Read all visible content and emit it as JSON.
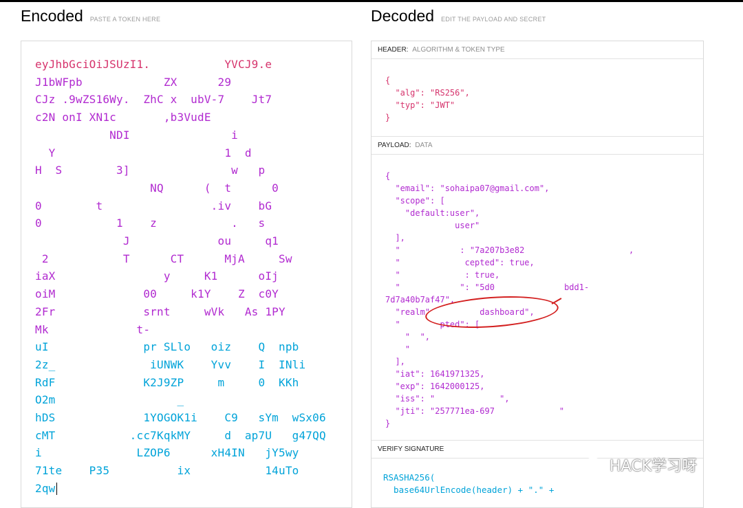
{
  "encoded": {
    "title": "Encoded",
    "subtitle": "PASTE A TOKEN HERE",
    "lines": [
      {
        "text": "eyJhbGciOiJSUzI1.           YVCJ9.e",
        "cls": "header"
      },
      {
        "text": "J1bWFpb            ZX      29",
        "cls": "payload"
      },
      {
        "text": "CJz .9wZS16Wy.  ZhC x  ubV-7    Jt7",
        "cls": "payload"
      },
      {
        "text": "c2N onI XN1c       ,b3VudE",
        "cls": "payload"
      },
      {
        "text": "           NDI               i",
        "cls": "payload"
      },
      {
        "text": "  Y                         1  d",
        "cls": "payload"
      },
      {
        "text": "H  S        3]               w   p",
        "cls": "payload"
      },
      {
        "text": "                 NQ      (  t      0",
        "cls": "payload"
      },
      {
        "text": "0        t                .iv    bG",
        "cls": "payload"
      },
      {
        "text": "0           1    z           .   s",
        "cls": "payload"
      },
      {
        "text": "             J             ou     q1",
        "cls": "payload"
      },
      {
        "text": " 2           T      CT      MjA     Sw",
        "cls": "payload"
      },
      {
        "text": "iaX                y     K1      oIj",
        "cls": "payload"
      },
      {
        "text": "oiM             00     k1Y    Z  c0Y",
        "cls": "payload"
      },
      {
        "text": "2Fr             srnt     wVk   As 1PY",
        "cls": "payload"
      },
      {
        "text": "Mk             t-",
        "cls": "payload"
      },
      {
        "text": "uI              pr SLlo   oiz    Q  npb",
        "cls": "sig"
      },
      {
        "text": "2z_              iUNWK    Yvv    I  INli",
        "cls": "sig"
      },
      {
        "text": "RdF             K2J9ZP     m     0  KKh",
        "cls": "sig"
      },
      {
        "text": "O2m                  _",
        "cls": "sig"
      },
      {
        "text": "hDS             1YOGOK1i    C9   sYm  wSx06",
        "cls": "sig"
      },
      {
        "text": "cMT           .cc7KqkMY     d  ap7U   g47QQ",
        "cls": "sig"
      },
      {
        "text": "i              LZOP6      xH4IN   jY5wy",
        "cls": "sig"
      },
      {
        "text": "71te    P35          ix           14uTo",
        "cls": "sig"
      },
      {
        "text": "2qw",
        "cls": "sig"
      }
    ]
  },
  "decoded": {
    "title": "Decoded",
    "subtitle": "EDIT THE PAYLOAD AND SECRET",
    "header_section": {
      "title": "HEADER:",
      "sub": "ALGORITHM & TOKEN TYPE"
    },
    "payload_section": {
      "title": "PAYLOAD:",
      "sub": "DATA"
    },
    "verify_section": {
      "title": "VERIFY SIGNATURE",
      "sub": ""
    },
    "header_json": "{\n  \"alg\": \"RS256\",\n  \"typ\": \"JWT\"\n}",
    "payload_json": "{\n  \"email\": \"sohaipa07@gmail.com\",\n  \"scope\": [\n    \"default:user\",\n              user\"\n  ],\n  \"            : \"7a207b3e82                     ,\n  \"             cepted\": true,\n  \"             : true,\n  \"            \": \"5d0              bdd1-\n7d7a40b7af47\",\n  \"realm\"          dashboard\",\n  \"        pted\": [\n    \"  \",\n    \"\n  ],\n  \"iat\": 1641971325,\n  \"exp\": 1642000125,\n  \"iss\": \"             \",\n  \"jti\": \"257771ea-697             \"\n}",
    "verify_code": "RSASHA256(\n  base64UrlEncode(header) + \".\" +"
  },
  "watermark": {
    "text": "HACK学习呀"
  },
  "colors": {
    "header": "#d6336c",
    "payload": "#b12ad0",
    "signature": "#00a3d9",
    "annotation": "#d31f1f"
  }
}
